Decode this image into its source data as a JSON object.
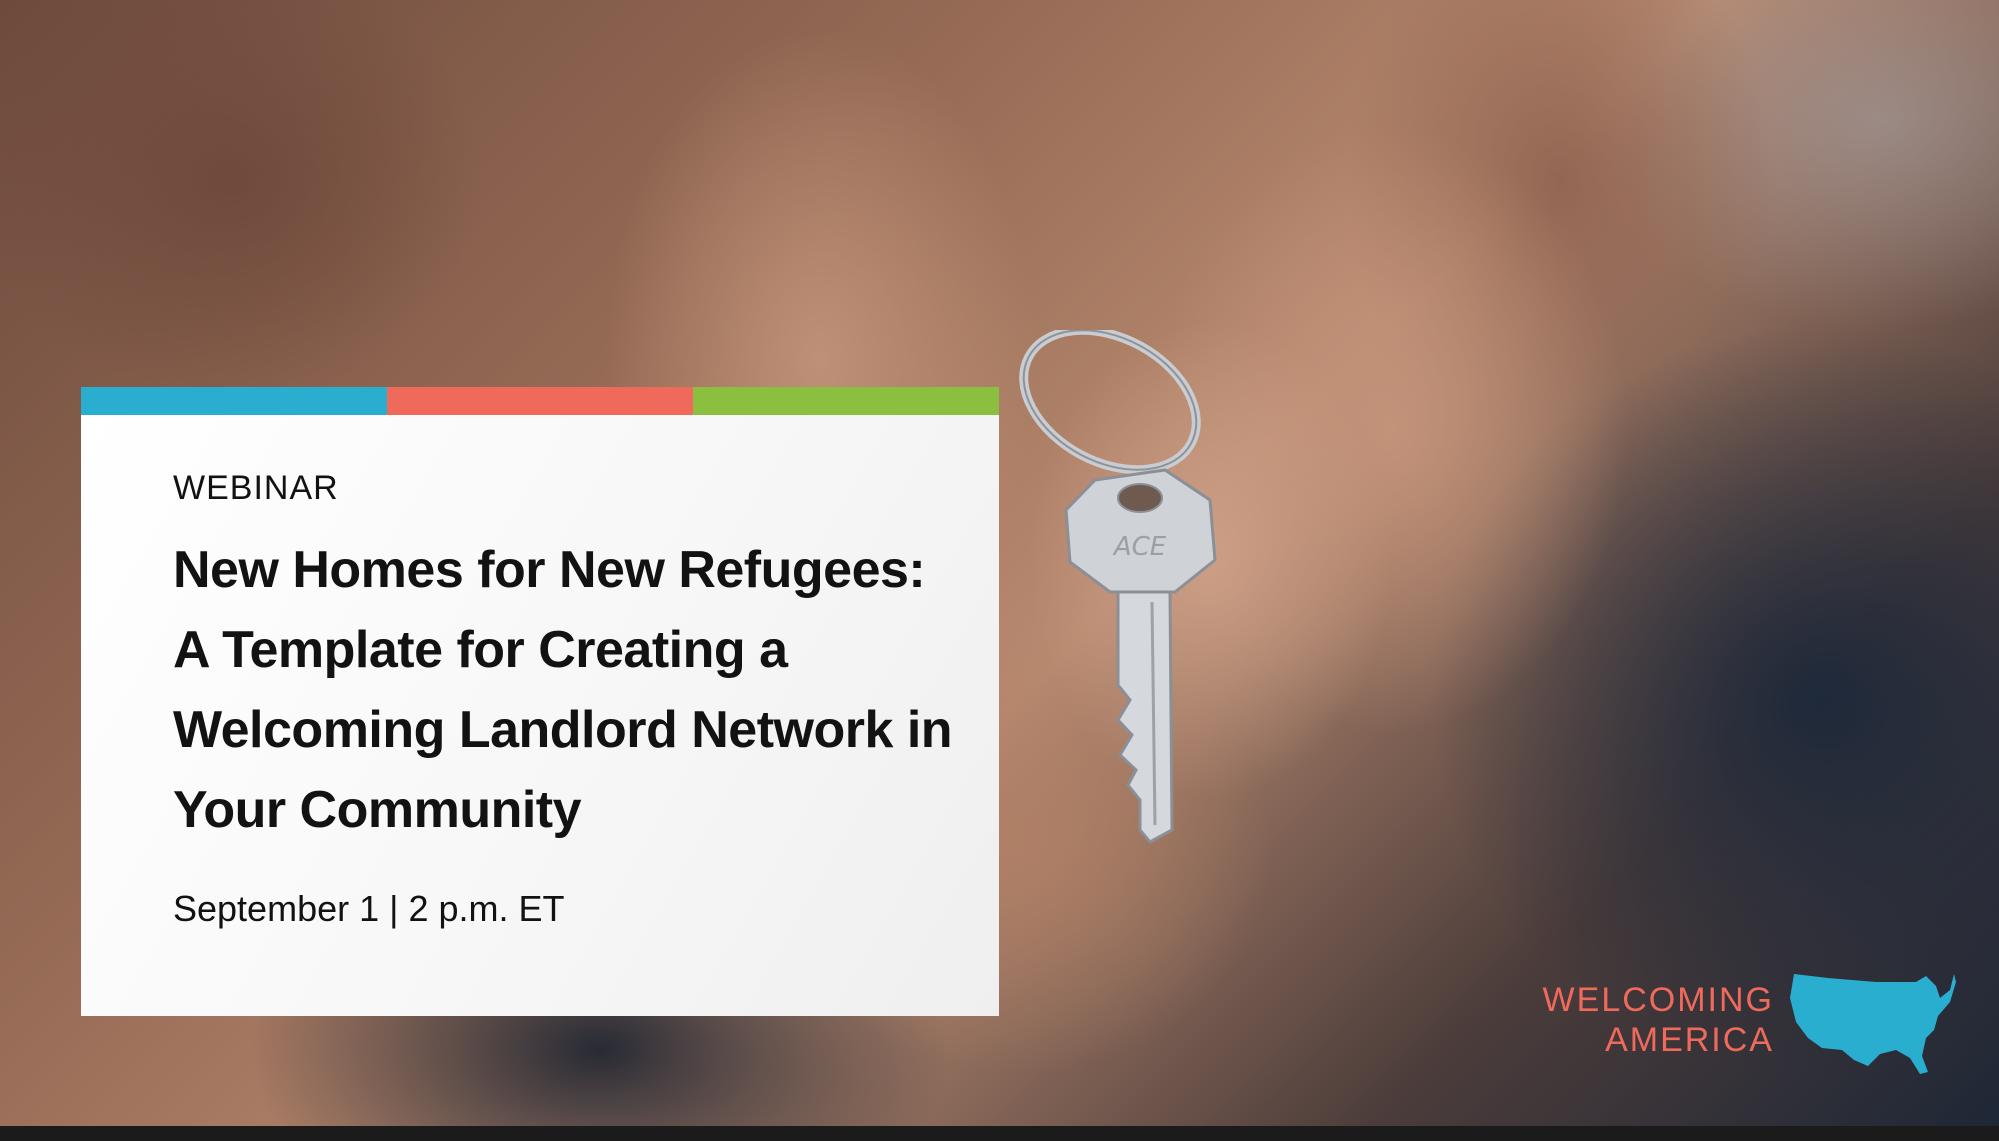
{
  "card": {
    "eyebrow": "WEBINAR",
    "title_lines": [
      "New Homes for New Refugees:",
      "A Template for Creating a",
      "Welcoming Landlord Network in",
      "Your Community"
    ],
    "date": "September 1 | 2 p.m. ET",
    "stripe_colors": [
      "#2aaed0",
      "#f06a5c",
      "#8cbe3f"
    ]
  },
  "logo": {
    "line1": "WELCOMING",
    "line2": "AMERICA",
    "text_color": "#f06a5c",
    "map_color": "#2aaed0",
    "icon": "usa-map-icon"
  },
  "photo": {
    "subject": "hands-holding-key-image"
  }
}
